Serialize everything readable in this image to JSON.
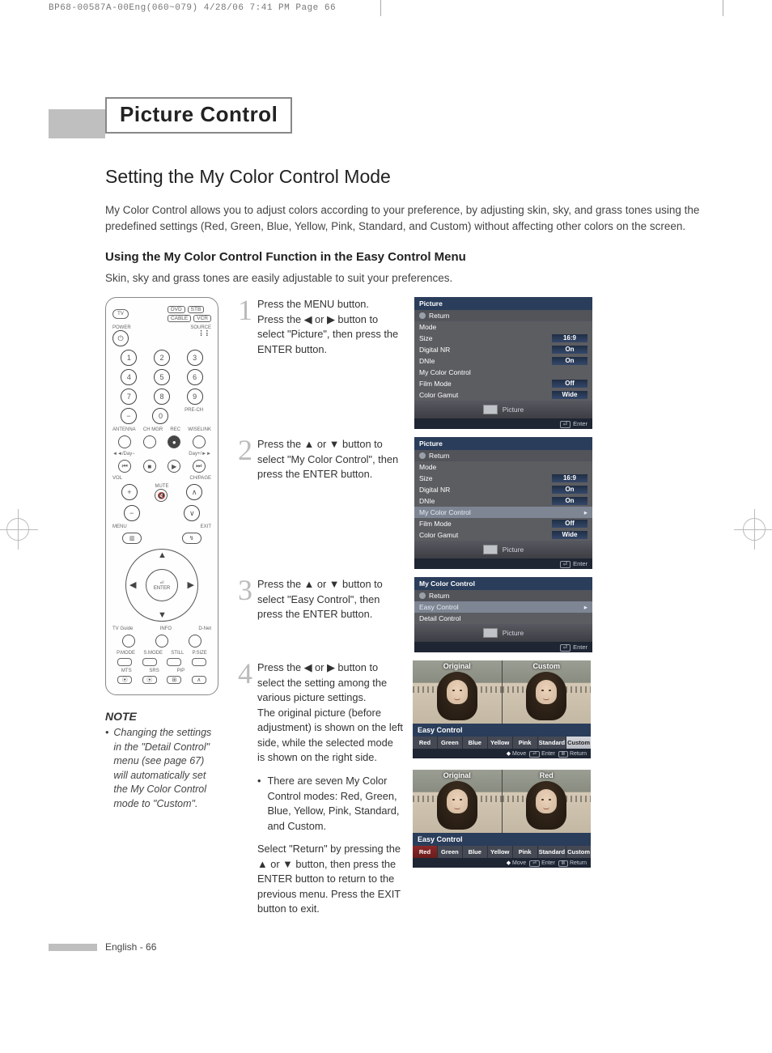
{
  "crop_header": "BP68-00587A-00Eng(060~079)  4/28/06  7:41 PM  Page 66",
  "title": "Picture Control",
  "heading": "Setting the My Color Control Mode",
  "intro": "My Color Control allows you to adjust colors according to your preference, by adjusting skin, sky, and grass tones using the predefined settings (Red, Green, Blue, Yellow, Pink, Standard, and Custom) without affecting other colors on the screen.",
  "subheading": "Using the My Color Control Function in the Easy Control Menu",
  "subtext": "Skin, sky and grass tones are easily adjustable to suit your preferences.",
  "remote": {
    "tv": "TV",
    "src": [
      "DVD",
      "STB",
      "CABLE",
      "VCR"
    ],
    "power": "POWER",
    "source": "SOURCE",
    "digits": [
      "1",
      "2",
      "3",
      "4",
      "5",
      "6",
      "7",
      "8",
      "9",
      "0"
    ],
    "dash": "−",
    "prech": "PRE-CH",
    "ant": "ANTENNA",
    "chmgr": "CH MGR",
    "rec": "REC",
    "wise": "WISELINK",
    "day_l": "◄◄/Day−",
    "day_r": "Day+/►►",
    "vol": "VOL",
    "mute": "MUTE",
    "chp": "CH/PAGE",
    "menu": "MENU",
    "exit": "EXIT",
    "enter": "ENTER",
    "tvguide": "TV Guide",
    "info": "INFO",
    "dnet": "D-Net",
    "row1": [
      "P.MODE",
      "S.MODE",
      "STILL",
      "P.SIZE"
    ],
    "row2": [
      "MTS",
      "SRS",
      "PIP",
      ""
    ]
  },
  "note": {
    "label": "NOTE",
    "text": "Changing the settings in the \"Detail Control\" menu (see page 67) will automatically set the My Color Control mode to \"Custom\"."
  },
  "steps": [
    {
      "n": "1",
      "text": "Press the MENU button.\nPress the ◀ or ▶ button to select \"Picture\", then press the ENTER button."
    },
    {
      "n": "2",
      "text": "Press the ▲ or ▼ button to select \"My Color Control\", then press the ENTER button."
    },
    {
      "n": "3",
      "text": "Press the ▲ or ▼ button to select \"Easy Control\", then press the ENTER button."
    },
    {
      "n": "4",
      "text": "Press the ◀ or ▶ button to select the setting among the various picture settings.\nThe original picture (before adjustment) is shown on the left side, while the selected mode is shown on the right side.",
      "bullet": "There are seven My Color Control modes: Red, Green, Blue, Yellow, Pink, Standard, and Custom.",
      "after": "Select \"Return\" by pressing the ▲ or ▼ button, then press the ENTER button to return to the previous menu. Press the EXIT button to exit."
    }
  ],
  "osd_picture": {
    "title": "Picture",
    "return": "Return",
    "rows": [
      {
        "label": "Mode",
        "value": ""
      },
      {
        "label": "Size",
        "value": "16:9"
      },
      {
        "label": "Digital NR",
        "value": "On"
      },
      {
        "label": "DNIe",
        "value": "On"
      },
      {
        "label": "My Color Control",
        "value": ""
      },
      {
        "label": "Film Mode",
        "value": "Off"
      },
      {
        "label": "Color Gamut",
        "value": "Wide"
      }
    ],
    "picbar": "Picture",
    "enter": "Enter"
  },
  "osd_mycc": {
    "title": "My Color Control",
    "return": "Return",
    "rows": [
      {
        "label": "Easy Control",
        "value": ""
      },
      {
        "label": "Detail Control",
        "value": ""
      }
    ],
    "picbar": "Picture",
    "enter": "Enter"
  },
  "easy": {
    "title": "Easy Control",
    "labels_a": [
      "Original",
      "Custom"
    ],
    "labels_b": [
      "Original",
      "Red"
    ],
    "opts": [
      "Red",
      "Green",
      "Blue",
      "Yellow",
      "Pink",
      "Standard",
      "Custom"
    ],
    "foot_move": "Move",
    "foot_enter": "Enter",
    "foot_return": "Return"
  },
  "footer": "English - 66"
}
